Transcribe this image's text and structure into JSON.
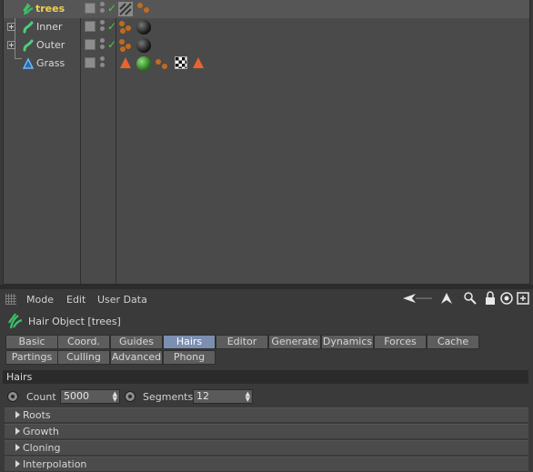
{
  "object_manager": {
    "objects": [
      {
        "name": "trees",
        "selected": true,
        "icon": "hair-icon",
        "checked": true,
        "expandable": false
      },
      {
        "name": "Inner",
        "selected": false,
        "icon": "spline-icon",
        "checked": true,
        "expandable": true
      },
      {
        "name": "Outer",
        "selected": false,
        "icon": "spline-icon",
        "checked": true,
        "expandable": true
      },
      {
        "name": "Grass",
        "selected": false,
        "icon": "polygon-icon",
        "checked": false,
        "expandable": false
      }
    ]
  },
  "attribute_manager": {
    "menu": [
      "Mode",
      "Edit",
      "User Data"
    ],
    "toolbar_icons": [
      "back-arrow-icon",
      "up-arrow-icon",
      "search-icon",
      "lock-icon",
      "target-icon",
      "new-window-icon"
    ],
    "object_title": "Hair Object [trees]",
    "tabs_row1": [
      "Basic",
      "Coord.",
      "Guides",
      "Hairs",
      "Editor",
      "Generate",
      "Dynamics",
      "Forces",
      "Cache"
    ],
    "tabs_row2": [
      "Partings",
      "Culling",
      "Advanced",
      "Phong"
    ],
    "active_tab": "Hairs",
    "group_title": "Hairs",
    "params": {
      "count_label": "Count",
      "count_value": "5000",
      "segments_label": "Segments",
      "segments_value": "12"
    },
    "sections": [
      "Roots",
      "Growth",
      "Cloning",
      "Interpolation"
    ]
  },
  "colors": {
    "selected_text": "#f2d04a",
    "active_tab": "#7b8fb0",
    "check": "#3fd03f",
    "warning_triangle": "#e8642e"
  }
}
